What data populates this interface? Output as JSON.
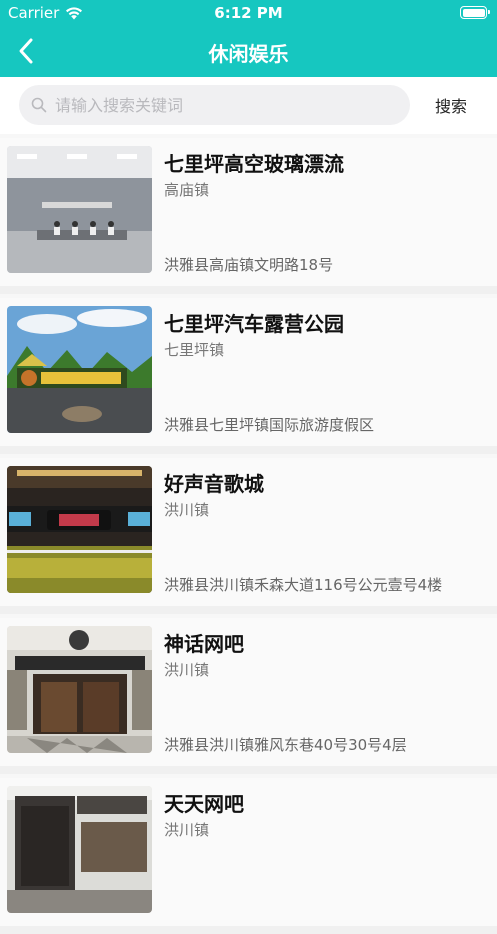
{
  "status": {
    "carrier": "Carrier",
    "time": "6:12 PM"
  },
  "nav": {
    "title": "休闲娱乐"
  },
  "search": {
    "placeholder": "请输入搜索关键词",
    "button": "搜索"
  },
  "items": [
    {
      "name": "七里坪高空玻璃漂流",
      "town": "高庙镇",
      "address": "洪雅县高庙镇文明路18号",
      "photo": "lobby"
    },
    {
      "name": "七里坪汽车露营公园",
      "town": "七里坪镇",
      "address": "洪雅县七里坪镇国际旅游度假区",
      "photo": "campsite"
    },
    {
      "name": "好声音歌城",
      "town": "洪川镇",
      "address": "洪雅县洪川镇禾森大道116号公元壹号4楼",
      "photo": "ktv"
    },
    {
      "name": "神话网吧",
      "town": "洪川镇",
      "address": "洪雅县洪川镇雅风东巷40号30号4层",
      "photo": "netcafe"
    },
    {
      "name": "天天网吧",
      "town": "洪川镇",
      "address": "",
      "photo": "netcafe2"
    }
  ]
}
